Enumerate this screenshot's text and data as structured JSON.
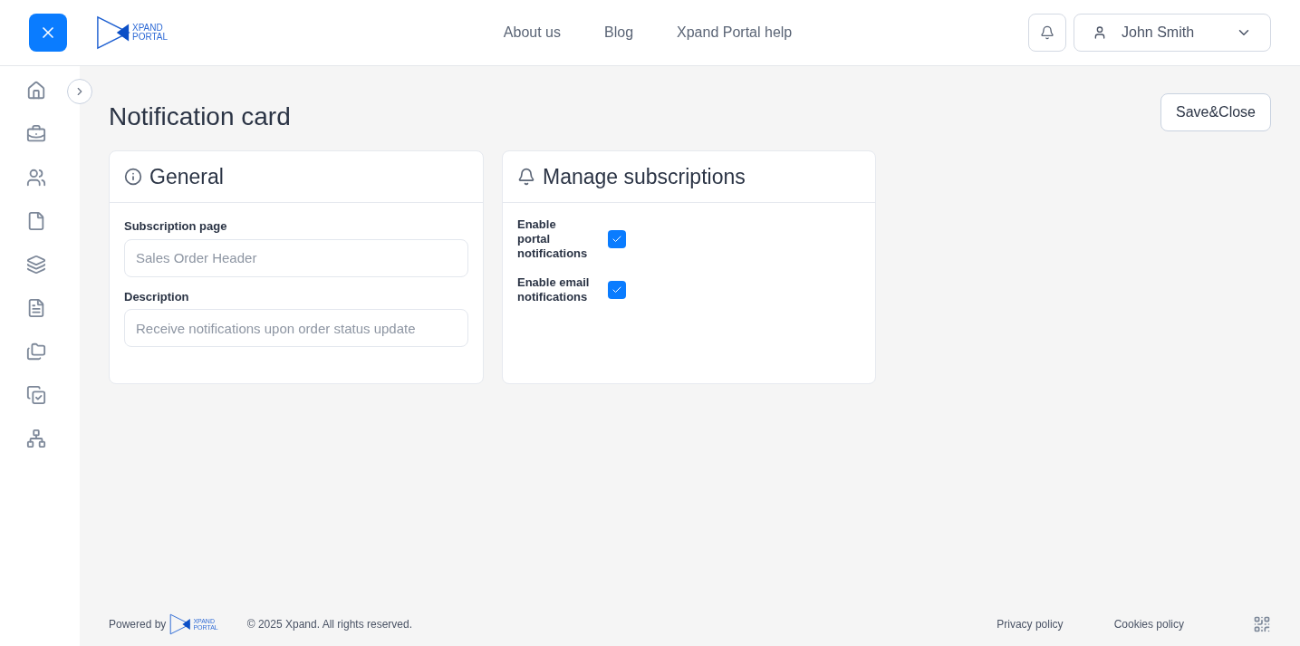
{
  "header": {
    "logo": {
      "line_1": "XPAND",
      "line_2": "PORTAL"
    },
    "nav": [
      "About us",
      "Blog",
      "Xpand Portal help"
    ],
    "user": {
      "name": "John Smith"
    }
  },
  "page": {
    "title": "Notification card",
    "save_button": "Save&Close"
  },
  "general": {
    "title": "General",
    "fields": [
      {
        "label": "Subscription page",
        "value": "Sales Order Header",
        "disabled": true
      },
      {
        "label": "Description",
        "value": "Receive notifications upon order status update",
        "disabled": true
      }
    ]
  },
  "subscriptions": {
    "title": "Manage subscriptions",
    "options": [
      {
        "label": "Enable portal notifications",
        "checked": true
      },
      {
        "label": "Enable email notifications",
        "checked": true
      }
    ]
  },
  "footer": {
    "powered_by": "Powered by",
    "logo": {
      "line_1": "XPAND",
      "line_2": "PORTAL"
    },
    "copyright": "© 2025 Xpand. All rights reserved.",
    "links": [
      "Privacy policy",
      "Cookies policy"
    ]
  }
}
